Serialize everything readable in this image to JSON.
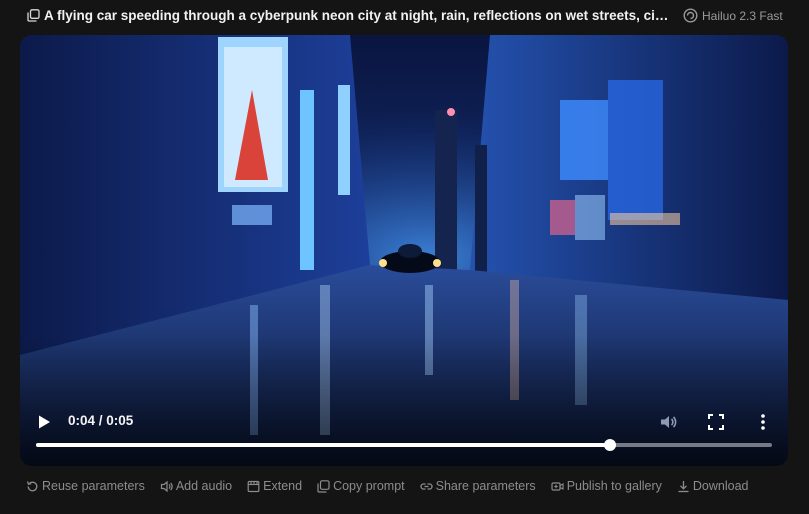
{
  "header": {
    "title": "A flying car speeding through a cyberpunk neon city at night, rain, reflections on wet streets, cinematic",
    "model": "Hailuo 2.3 Fast"
  },
  "player": {
    "current_time": "0:04",
    "duration": "0:05",
    "time_display": "0:04 / 0:05",
    "progress_fraction": 0.78
  },
  "actions": {
    "reuse": "Reuse parameters",
    "add_audio": "Add audio",
    "extend": "Extend",
    "copy_prompt": "Copy prompt",
    "share": "Share parameters",
    "publish": "Publish to gallery",
    "download": "Download"
  },
  "colors": {
    "background": "#141414",
    "muted_text": "#8c8c8c",
    "title_text": "#f2f2f2"
  }
}
